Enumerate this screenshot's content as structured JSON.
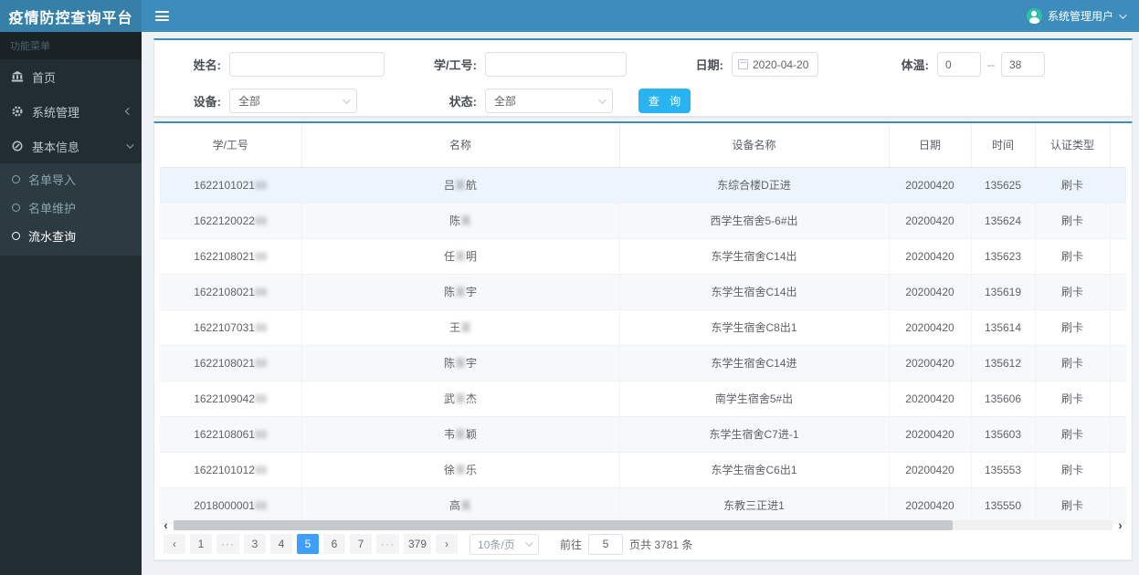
{
  "header": {
    "title": "疫情防控查询平台",
    "user_label": "系统管理用户"
  },
  "sidebar": {
    "section_label": "功能菜单",
    "items": [
      {
        "label": "首页"
      },
      {
        "label": "系统管理"
      },
      {
        "label": "基本信息"
      }
    ],
    "subitems": [
      {
        "label": "名单导入"
      },
      {
        "label": "名单维护"
      },
      {
        "label": "流水查询"
      }
    ]
  },
  "filters": {
    "name_label": "姓名:",
    "id_label": "学/工号:",
    "date_label": "日期:",
    "date_value": "2020-04-20",
    "temp_label": "体温:",
    "temp_min": "0",
    "temp_sep": "--",
    "temp_max": "38",
    "device_label": "设备:",
    "device_value": "全部",
    "status_label": "状态:",
    "status_value": "全部",
    "search_button": "查 询"
  },
  "table": {
    "headers": [
      "学/工号",
      "名称",
      "设备名称",
      "日期",
      "时间",
      "认证类型"
    ],
    "rows": [
      {
        "id": "1622101021",
        "id_masked": "88",
        "name_pre": "吕",
        "name_masked": "某",
        "name_post": "航",
        "device": "东综合楼D正进",
        "date": "20200420",
        "time": "135625",
        "auth": "刷卡",
        "highlight": true
      },
      {
        "id": "1622120022",
        "id_masked": "88",
        "name_pre": "陈",
        "name_masked": "某",
        "name_post": "",
        "device": "西学生宿舍5-6#出",
        "date": "20200420",
        "time": "135624",
        "auth": "刷卡"
      },
      {
        "id": "1622108021",
        "id_masked": "88",
        "name_pre": "任",
        "name_masked": "某",
        "name_post": "明",
        "device": "东学生宿舍C14出",
        "date": "20200420",
        "time": "135623",
        "auth": "刷卡"
      },
      {
        "id": "1622108021",
        "id_masked": "88",
        "name_pre": "陈",
        "name_masked": "某",
        "name_post": "宇",
        "device": "东学生宿舍C14出",
        "date": "20200420",
        "time": "135619",
        "auth": "刷卡"
      },
      {
        "id": "1622107031",
        "id_masked": "88",
        "name_pre": "王",
        "name_masked": "某",
        "name_post": "",
        "device": "东学生宿舍C8出1",
        "date": "20200420",
        "time": "135614",
        "auth": "刷卡"
      },
      {
        "id": "1622108021",
        "id_masked": "88",
        "name_pre": "陈",
        "name_masked": "某",
        "name_post": "宇",
        "device": "东学生宿舍C14进",
        "date": "20200420",
        "time": "135612",
        "auth": "刷卡"
      },
      {
        "id": "1622109042",
        "id_masked": "88",
        "name_pre": "武",
        "name_masked": "某",
        "name_post": "杰",
        "device": "南学生宿舍5#出",
        "date": "20200420",
        "time": "135606",
        "auth": "刷卡"
      },
      {
        "id": "1622108061",
        "id_masked": "88",
        "name_pre": "韦",
        "name_masked": "某",
        "name_post": "颖",
        "device": "东学生宿舍C7进-1",
        "date": "20200420",
        "time": "135603",
        "auth": "刷卡"
      },
      {
        "id": "1622101012",
        "id_masked": "88",
        "name_pre": "徐",
        "name_masked": "某",
        "name_post": "乐",
        "device": "东学生宿舍C6出1",
        "date": "20200420",
        "time": "135553",
        "auth": "刷卡"
      },
      {
        "id": "2018000001",
        "id_masked": "88",
        "name_pre": "高",
        "name_masked": "某",
        "name_post": "",
        "device": "东教三正进1",
        "date": "20200420",
        "time": "135550",
        "auth": "刷卡"
      }
    ]
  },
  "pagination": {
    "pages": [
      "1",
      "...",
      "3",
      "4",
      "5",
      "6",
      "7",
      "...",
      "379"
    ],
    "active_page": "5",
    "page_size": "10条/页",
    "goto_label": "前往",
    "goto_value": "5",
    "goto_suffix": "页",
    "total_label": "共 3781 条"
  },
  "icons": {
    "prev_arrow": "‹",
    "next_arrow": "›",
    "ellipsis": "···",
    "scroll_left": "‹",
    "scroll_right": "›"
  },
  "colors": {
    "header_bg": "#3c8dbc",
    "logo_bg": "#367fa9",
    "sidebar_bg": "#222d32",
    "submenu_bg": "#2c3b41",
    "query_button": "#29b4f1",
    "active_page": "#409eff",
    "highlight_row": "#ecf5fd",
    "avatar": "#2fbfa9"
  }
}
